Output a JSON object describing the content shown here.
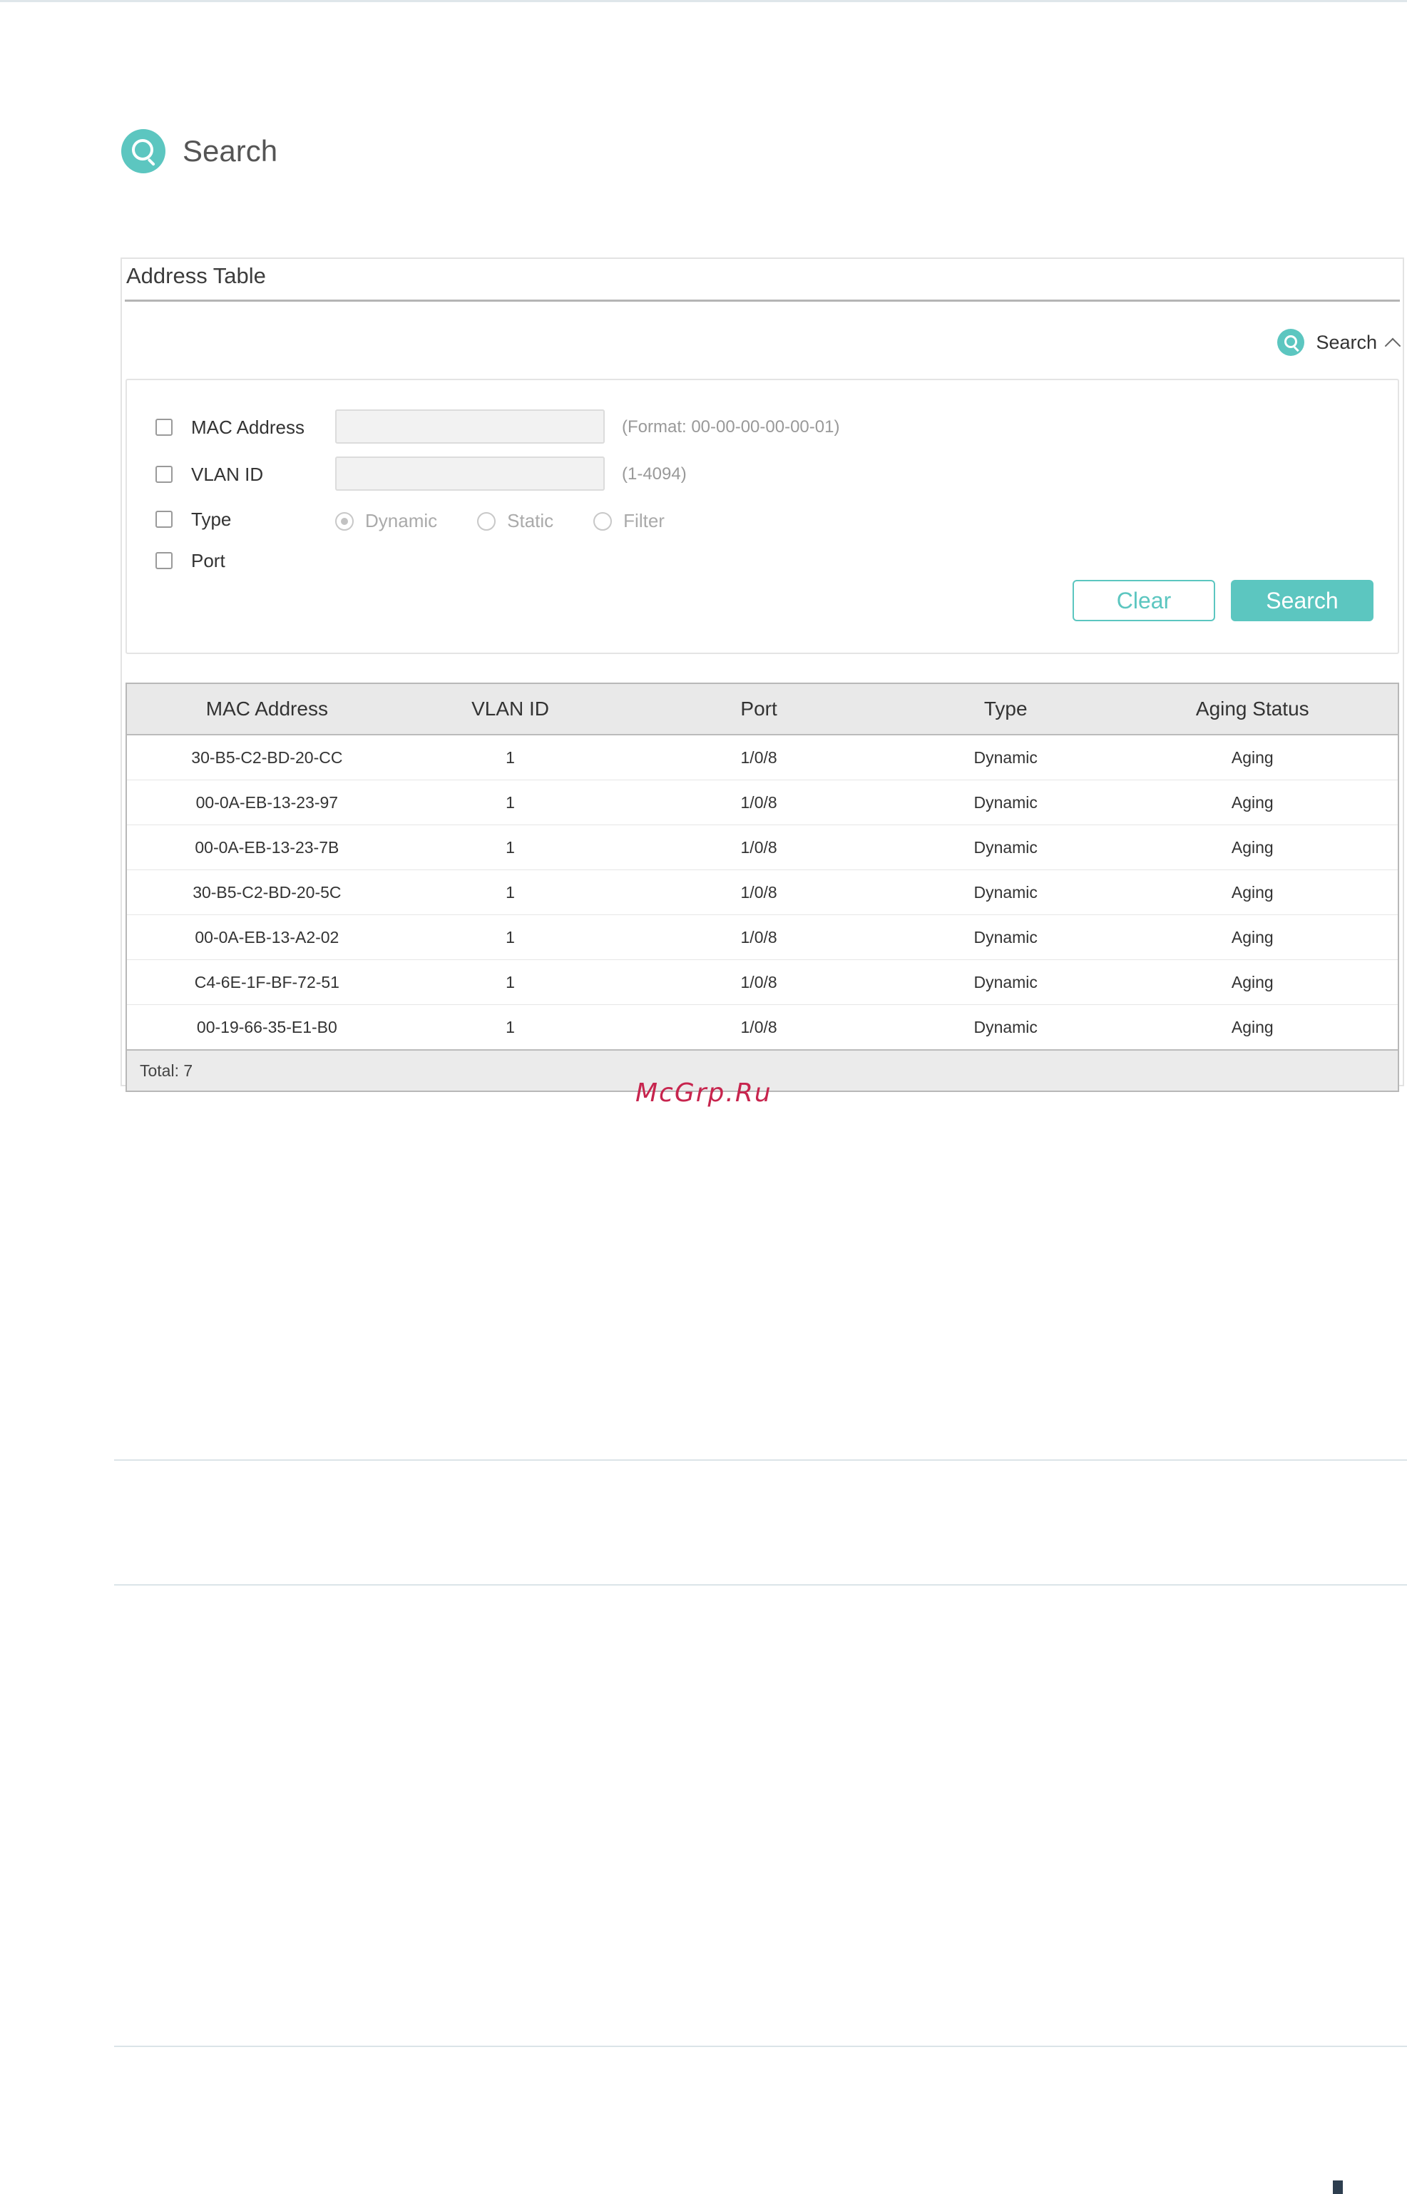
{
  "page": {
    "heading": "Search"
  },
  "panel": {
    "title": "Address Table",
    "search_toggle_label": "Search"
  },
  "form": {
    "mac": {
      "label": "MAC Address",
      "value": "",
      "hint": "(Format: 00-00-00-00-00-01)"
    },
    "vlan": {
      "label": "VLAN ID",
      "value": "",
      "hint": "(1-4094)"
    },
    "type": {
      "label": "Type",
      "options": [
        {
          "label": "Dynamic",
          "selected": true
        },
        {
          "label": "Static",
          "selected": false
        },
        {
          "label": "Filter",
          "selected": false
        }
      ]
    },
    "port": {
      "label": "Port"
    },
    "clear_label": "Clear",
    "search_label": "Search"
  },
  "table": {
    "headers": [
      "MAC Address",
      "VLAN ID",
      "Port",
      "Type",
      "Aging Status"
    ],
    "rows": [
      [
        "30-B5-C2-BD-20-CC",
        "1",
        "1/0/8",
        "Dynamic",
        "Aging"
      ],
      [
        "00-0A-EB-13-23-97",
        "1",
        "1/0/8",
        "Dynamic",
        "Aging"
      ],
      [
        "00-0A-EB-13-23-7B",
        "1",
        "1/0/8",
        "Dynamic",
        "Aging"
      ],
      [
        "30-B5-C2-BD-20-5C",
        "1",
        "1/0/8",
        "Dynamic",
        "Aging"
      ],
      [
        "00-0A-EB-13-A2-02",
        "1",
        "1/0/8",
        "Dynamic",
        "Aging"
      ],
      [
        "C4-6E-1F-BF-72-51",
        "1",
        "1/0/8",
        "Dynamic",
        "Aging"
      ],
      [
        "00-19-66-35-E1-B0",
        "1",
        "1/0/8",
        "Dynamic",
        "Aging"
      ]
    ],
    "total": "Total: 7"
  },
  "watermark": "McGrp.Ru",
  "colors": {
    "accent": "#5cc6c0",
    "header_bg": "#e9e9e9",
    "watermark": "#c7254e"
  }
}
